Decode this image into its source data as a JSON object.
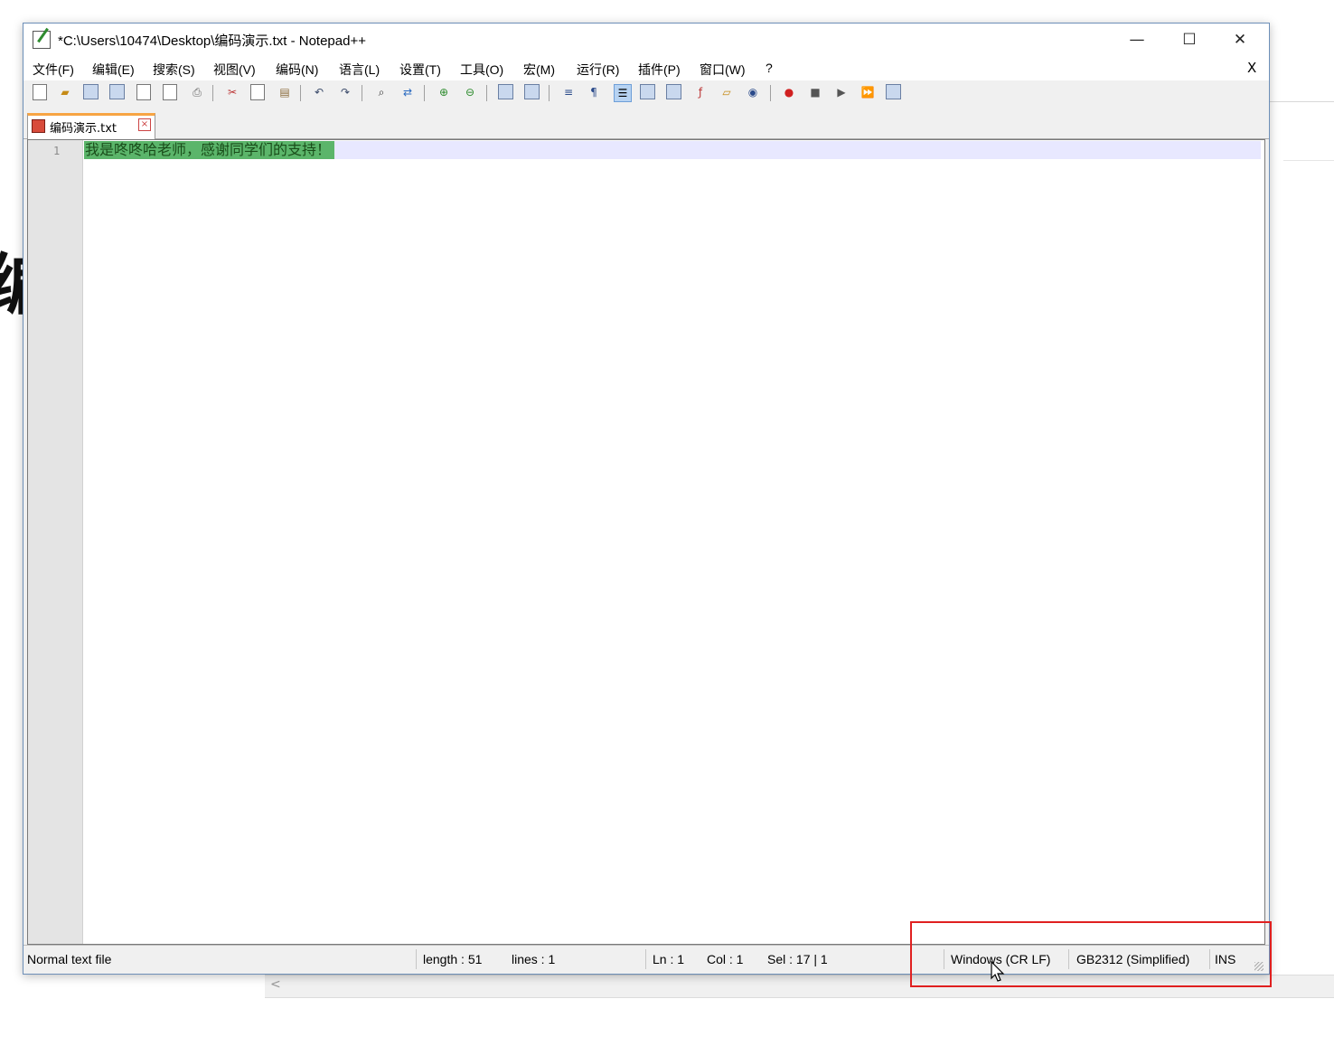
{
  "window": {
    "title": "*C:\\Users\\10474\\Desktop\\编码演示.txt - Notepad++",
    "minimize_glyph": "—",
    "maximize_glyph": "☐",
    "close_glyph": "✕"
  },
  "menu": {
    "items": [
      "文件(F)",
      "编辑(E)",
      "搜索(S)",
      "视图(V)",
      "编码(N)",
      "语言(L)",
      "设置(T)",
      "工具(O)",
      "宏(M)",
      "运行(R)",
      "插件(P)",
      "窗口(W)",
      "?"
    ],
    "close_doc": "X"
  },
  "toolbar": {
    "icons": [
      "new-file-icon",
      "open-file-icon",
      "save-icon",
      "save-all-icon",
      "close-icon",
      "close-all-icon",
      "print-icon",
      "cut-icon",
      "copy-icon",
      "paste-icon",
      "undo-icon",
      "redo-icon",
      "find-icon",
      "replace-icon",
      "zoom-in-icon",
      "zoom-out-icon",
      "sync-vertical-icon",
      "sync-horizontal-icon",
      "word-wrap-icon",
      "show-all-chars-icon",
      "indent-guide-icon",
      "user-language-icon",
      "doc-map-icon",
      "function-list-icon",
      "folder-workspace-icon",
      "monitor-icon",
      "record-macro-icon",
      "stop-record-icon",
      "playback-macro-icon",
      "run-macro-multiple-icon",
      "save-macro-icon"
    ]
  },
  "tab": {
    "label": "编码演示.txt",
    "close": "×"
  },
  "editor": {
    "line_number": "1",
    "text": "我是咚咚哈老师，感谢同学们的支持！"
  },
  "status": {
    "file_type": "Normal text file",
    "length": "length : 51",
    "lines": "lines : 1",
    "ln": "Ln : 1",
    "col": "Col : 1",
    "sel": "Sel : 17 | 1",
    "eol": "Windows (CR LF)",
    "encoding": "GB2312 (Simplified)",
    "mode": "INS"
  },
  "background": {
    "glyph": "编",
    "scroll_arrow": "<"
  },
  "colors": {
    "selection": "#5bb56a",
    "current_line": "#e8e8ff",
    "annotation_box": "#e02020",
    "tab_accent": "#f7a443"
  }
}
